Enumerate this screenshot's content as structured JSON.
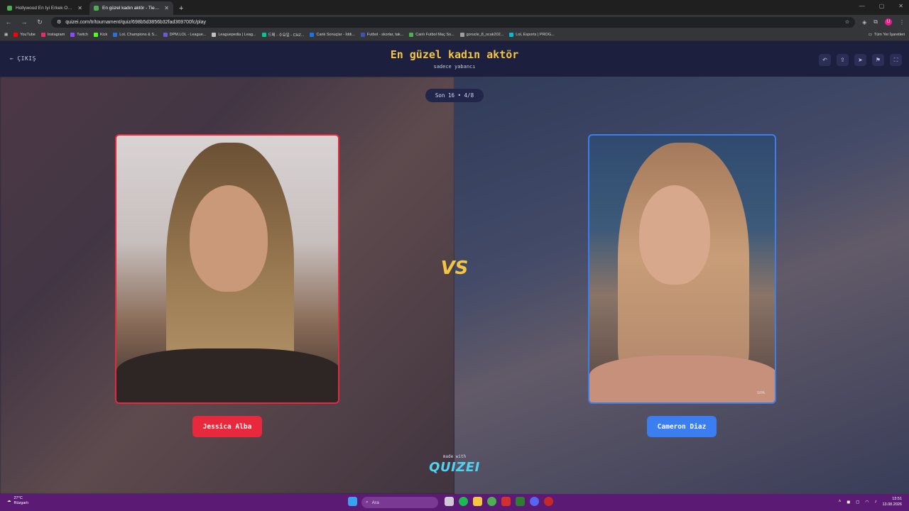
{
  "browser": {
    "tabs": [
      {
        "title": "Hollywood En İyi Erkek Oyuncu...",
        "active": false
      },
      {
        "title": "En güzel kadın aktör - Tier List...",
        "active": true
      }
    ],
    "new_tab": "+",
    "url": "quizei.com/tr/tournament/quiz/698b5d3856b32fad369700fc/play",
    "bookmarks": [
      {
        "label": "YouTube",
        "color": "#ff0000"
      },
      {
        "label": "Instagram",
        "color": "#e1306c"
      },
      {
        "label": "Twitch",
        "color": "#9146ff"
      },
      {
        "label": "Kick",
        "color": "#53fc18"
      },
      {
        "label": "LoL Champions & S...",
        "color": "#2a6fdb"
      },
      {
        "label": "DPM.LOL - League...",
        "color": "#6a5acd"
      },
      {
        "label": "Leaguepedia | Leag...",
        "color": "#c0c0c0"
      },
      {
        "label": "드페 - 수요일 - CHZ...",
        "color": "#00c896"
      },
      {
        "label": "Canlı Sonuçlar - İddi...",
        "color": "#1a73e8"
      },
      {
        "label": "Futbol - skorlar, tak...",
        "color": "#3f51b5"
      },
      {
        "label": "Canlı Futbol Maç So...",
        "color": "#4caf50"
      },
      {
        "label": "gorucle_8_ocak202...",
        "color": "#9e9e9e"
      },
      {
        "label": "LoL Esports | PROG...",
        "color": "#00bcd4"
      }
    ],
    "bookmarks_all": "Tüm Yer İşaretleri"
  },
  "header": {
    "exit_label": "ÇIKIŞ",
    "title": "En güzel kadın aktör",
    "subtitle": "sadece yabancı",
    "tools": [
      "undo-icon",
      "share-icon",
      "send-icon",
      "flag-icon",
      "fullscreen-icon"
    ]
  },
  "round": "Son 16 • 4/8",
  "contestants": {
    "left": {
      "name": "Jessica Alba",
      "color": "#e8283c"
    },
    "right": {
      "name": "Cameron Diaz",
      "color": "#3a7ef0",
      "photo_credit": "SIPA"
    }
  },
  "vs_label": "VS",
  "footer": {
    "made_with": "made with",
    "logo": "QUIZEI"
  },
  "taskbar": {
    "weather_temp": "27°C",
    "weather_desc": "Rüzgarlı",
    "search_placeholder": "Ara",
    "time": "13:51",
    "date": "13.08.2026"
  }
}
